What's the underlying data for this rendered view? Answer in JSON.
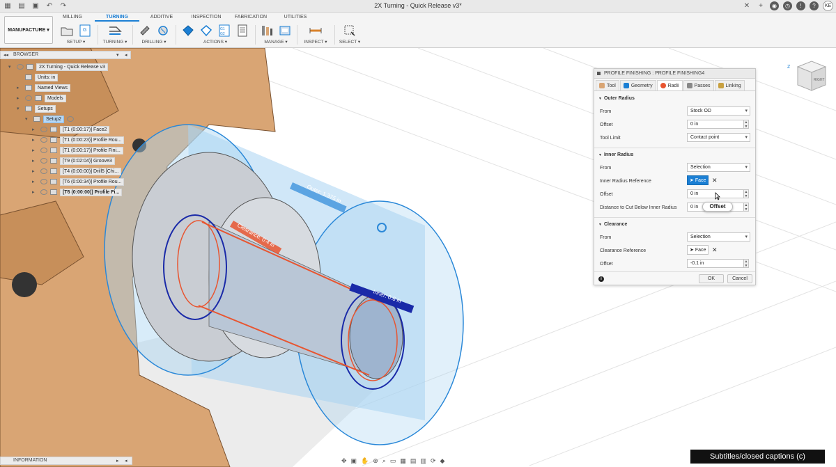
{
  "window": {
    "title": "2X Turning - Quick Release v3*",
    "user_initials": "KE"
  },
  "ribbon": {
    "workspace": "MANUFACTURE ▾",
    "tabs": [
      "MILLING",
      "TURNING",
      "ADDITIVE",
      "INSPECTION",
      "FABRICATION",
      "UTILITIES"
    ],
    "active_tab": "TURNING",
    "groups": {
      "setup": "SETUP ▾",
      "turning": "TURNING ▾",
      "drilling": "DRILLING ▾",
      "actions": "ACTIONS ▾",
      "manage": "MANAGE ▾",
      "inspect": "INSPECT ▾",
      "select": "SELECT ▾"
    }
  },
  "browser": {
    "title": "BROWSER",
    "root": "2X Turning - Quick Release v3",
    "units": "Units: in",
    "named_views": "Named Views",
    "models": "Models",
    "setups": "Setups",
    "setup2": "Setup2",
    "operations": [
      "[T1 (0:00:17)] Face2",
      "[T1 (0:00:23)] Profile Rou...",
      "[T1 (0:00:17)] Profile Fini...",
      "[T9 (0:02:04)] Groove3",
      "[T4 (0:00:00)] Drill5 [Chi...",
      "[T6 (0:00:34)] Profile Rou...",
      "[T6 (0:00:00)] Profile Fi..."
    ]
  },
  "info_bar": {
    "label": "INFORMATION"
  },
  "captions": "Subtitles/closed captions (c)",
  "viewport": {
    "outer_label": "Outer: 1.375 in",
    "clearance_label": "Clearance: 0.4 in",
    "inner_label": "Inner: 0.6 in",
    "cube_face": "RIGHT",
    "axis_z": "Z"
  },
  "dialog": {
    "title": "PROFILE FINISHING : PROFILE FINISHING4",
    "tabs": [
      "Tool",
      "Geometry",
      "Radii",
      "Passes",
      "Linking"
    ],
    "active_tab": "Radii",
    "outer_radius": {
      "heading": "Outer Radius",
      "from_label": "From",
      "from_value": "Stock OD",
      "offset_label": "Offset",
      "offset_value": "0 in",
      "tool_limit_label": "Tool Limit",
      "tool_limit_value": "Contact point"
    },
    "inner_radius": {
      "heading": "Inner Radius",
      "from_label": "From",
      "from_value": "Selection",
      "reference_label": "Inner Radius Reference",
      "reference_value": "Face",
      "offset_label": "Offset",
      "offset_value": "0 in",
      "cut_below_label": "Distance to Cut Below Inner Radius",
      "cut_below_value": "0 in",
      "tooltip": "Offset"
    },
    "clearance": {
      "heading": "Clearance",
      "from_label": "From",
      "from_value": "Selection",
      "reference_label": "Clearance Reference",
      "reference_value": "Face",
      "offset_label": "Offset",
      "offset_value": "-0.1 in"
    },
    "ok": "OK",
    "cancel": "Cancel"
  },
  "colors": {
    "accent": "#1b7fd4",
    "part": "#d9a574",
    "clearance_zone": "#a9d4f2",
    "outer_ring": "#2a88d8",
    "inner_ring": "#1a2aa8",
    "cut_line": "#e85530"
  }
}
